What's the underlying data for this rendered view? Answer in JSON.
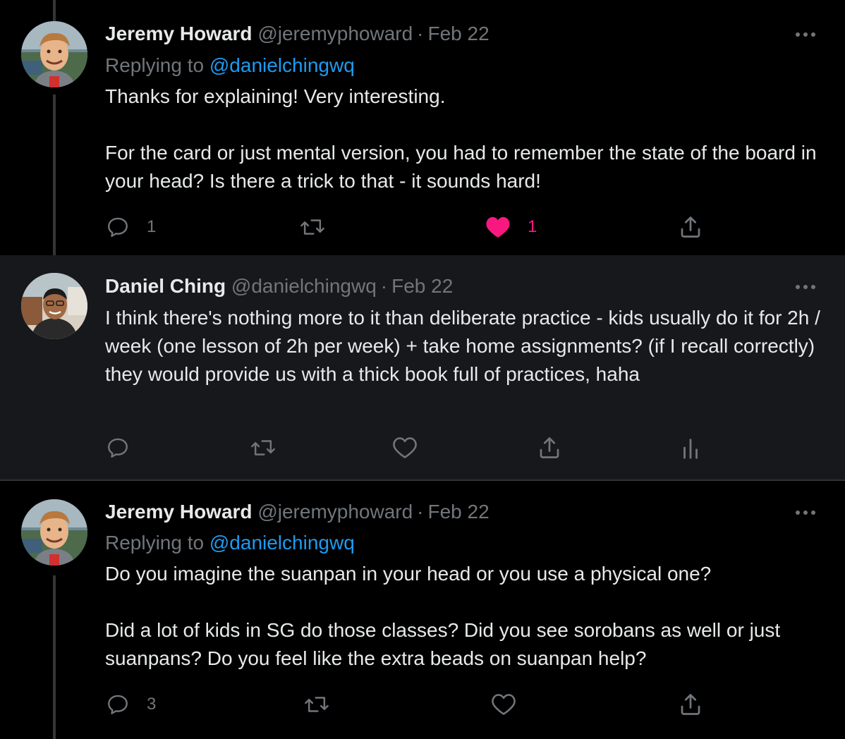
{
  "tweets": [
    {
      "author": {
        "name": "Jeremy Howard",
        "handle": "@jeremyphoward",
        "avatar_icon": "avatar-jeremy"
      },
      "separator": "·",
      "date": "Feb 22",
      "replying": {
        "prefix": "Replying to",
        "mention": "@danielchingwq"
      },
      "paragraphs": [
        "Thanks for explaining! Very interesting.",
        "For the card or just mental version, you had to remember the state of the board in your head? Is there a trick to that - it sounds hard!"
      ],
      "actions": {
        "reply_count": "1",
        "retweet_count": "",
        "like_count": "1",
        "liked": true
      }
    },
    {
      "author": {
        "name": "Daniel Ching",
        "handle": "@danielchingwq",
        "avatar_icon": "avatar-daniel"
      },
      "separator": "·",
      "date": "Feb 22",
      "lines": [
        "I think there's nothing more to it than deliberate practice - kids usually do it for 2h / week (one lesson of 2h per week) + take home assignments? (if I recall correctly)",
        "they would provide us with a thick book full of practices, haha"
      ],
      "actions": {
        "reply_count": "",
        "retweet_count": "",
        "like_count": "",
        "liked": false,
        "analytics_icon": "bar-chart-icon"
      }
    },
    {
      "author": {
        "name": "Jeremy Howard",
        "handle": "@jeremyphoward",
        "avatar_icon": "avatar-jeremy"
      },
      "separator": "·",
      "date": "Feb 22",
      "replying": {
        "prefix": "Replying to",
        "mention": "@danielchingwq"
      },
      "paragraphs": [
        "Do you imagine the suanpan in your head or you use a physical one?",
        "Did a lot of kids in SG do those classes? Did you see sorobans as well or just suanpans? Do you feel like the extra beads on suanpan help?"
      ],
      "actions": {
        "reply_count": "3",
        "retweet_count": "",
        "like_count": "",
        "liked": false
      }
    }
  ],
  "colors": {
    "background": "#000000",
    "highlight_background": "#16181c",
    "text": "#e7e9ea",
    "secondary": "#71767b",
    "link": "#1d9bf0",
    "like": "#f91880",
    "divider": "#2f3336"
  }
}
